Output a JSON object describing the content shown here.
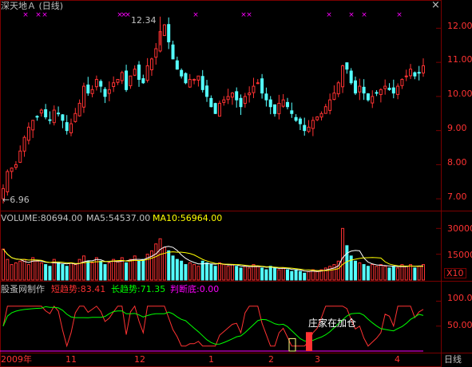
{
  "window": {
    "title": "深天地Ａ (日线)",
    "close_glyph": "×"
  },
  "colors": {
    "up": "#ff3232",
    "down": "#54ffff",
    "grid": "#7a0000",
    "axis_text": "#ff3232",
    "text_white": "#c0c0c0",
    "ma5": "#ffffff",
    "ma10": "#ffff00",
    "magenta": "#ff00ff",
    "green": "#00ff00"
  },
  "price_panel": {
    "high_label": "12.34",
    "low_label": "←6.96",
    "y_ticks": [
      "12.00",
      "11.00",
      "10.00",
      "9.00",
      "8.00",
      "7.00"
    ]
  },
  "volume_panel": {
    "label_volume": "VOLUME:80694.00",
    "label_ma5": "MA5:54537.00",
    "label_ma10": "MA10:56964.00",
    "y_ticks": [
      "30000",
      "15000"
    ],
    "unit_badge": "X10"
  },
  "indicator_panel": {
    "name": "股蚤网制作",
    "short_trend": "短趋势:83.41",
    "long_trend": "长趋势:71.35",
    "bottom_judge": "判断底:0.00",
    "annotation": "庄家在加仓",
    "y_ticks": [
      "100.0",
      "50.00"
    ]
  },
  "time_axis": {
    "labels": [
      "2009年",
      "11",
      "12",
      "1",
      "2",
      "3",
      "4"
    ],
    "period": "日线"
  },
  "chart_data": {
    "type": "candlestick",
    "price_range": [
      6.7,
      12.5
    ],
    "annotated_high": 12.34,
    "annotated_low": 6.96,
    "close": [
      7.3,
      7.8,
      7.9,
      8.0,
      8.4,
      8.8,
      9.1,
      9.3,
      9.4,
      9.6,
      9.4,
      9.3,
      9.6,
      9.5,
      9.3,
      9.0,
      9.2,
      9.5,
      9.8,
      10.3,
      10.1,
      10.2,
      10.5,
      10.3,
      10.0,
      10.2,
      10.4,
      10.5,
      10.7,
      10.2,
      10.6,
      10.8,
      10.5,
      10.4,
      10.9,
      11.1,
      11.4,
      11.9,
      12.1,
      11.6,
      11.1,
      10.8,
      10.6,
      10.4,
      10.5,
      10.5,
      10.6,
      10.2,
      10.0,
      9.7,
      9.5,
      9.8,
      9.9,
      10.0,
      10.1,
      9.9,
      9.7,
      10.0,
      10.1,
      10.3,
      10.4,
      10.1,
      9.9,
      9.7,
      9.5,
      9.8,
      9.9,
      9.7,
      9.5,
      9.3,
      9.2,
      9.0,
      9.1,
      9.3,
      9.4,
      9.5,
      9.7,
      9.9,
      10.1,
      10.4,
      10.9,
      10.8,
      10.4,
      10.1,
      10.3,
      10.1,
      9.9,
      10.0,
      10.1,
      10.2,
      10.3,
      10.2,
      10.1,
      10.3,
      10.5,
      10.6,
      10.8,
      10.6,
      10.7,
      10.9
    ],
    "volume": [
      18000,
      12000,
      9000,
      10000,
      11000,
      12000,
      9000,
      13000,
      11000,
      10000,
      9000,
      8000,
      12000,
      10000,
      9000,
      8000,
      10000,
      9000,
      12000,
      14000,
      11000,
      10000,
      13000,
      11000,
      9000,
      10000,
      12000,
      11000,
      13000,
      10000,
      12000,
      14000,
      11000,
      12000,
      15000,
      17000,
      21000,
      24000,
      19000,
      17000,
      14000,
      12000,
      11000,
      9000,
      10000,
      9000,
      8000,
      11000,
      10000,
      9000,
      8000,
      10000,
      9000,
      8000,
      9000,
      8000,
      7000,
      8000,
      7000,
      9000,
      8000,
      7000,
      6000,
      8000,
      7000,
      6000,
      7000,
      6000,
      5000,
      6000,
      5000,
      4000,
      5000,
      6000,
      5000,
      6000,
      7000,
      8000,
      9000,
      11000,
      30000,
      20000,
      14000,
      11000,
      10000,
      9000,
      8000,
      9000,
      8000,
      9000,
      8000,
      7000,
      8000,
      7000,
      9000,
      8000,
      9000,
      7000,
      8000,
      9000
    ],
    "volume_range": [
      0,
      32000
    ],
    "indicator_range": [
      0,
      120
    ],
    "indicator_ticks": [
      50,
      100
    ],
    "short_trend_last": 83.41,
    "long_trend_last": 71.35,
    "bottom_judge_last": 0.0
  }
}
